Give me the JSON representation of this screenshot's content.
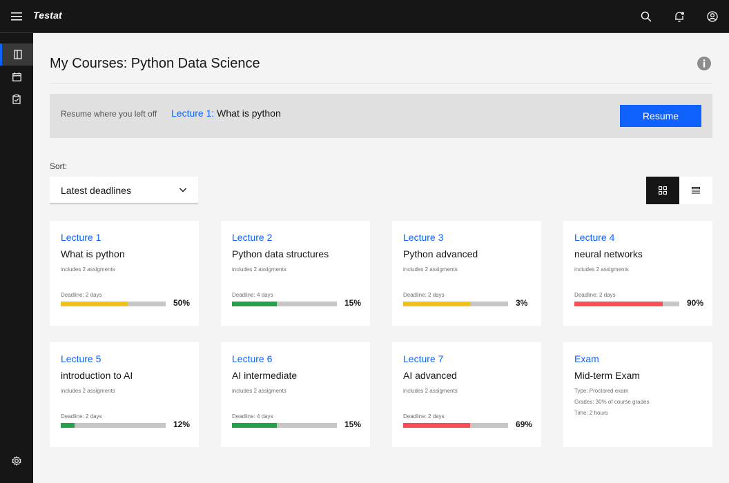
{
  "app": {
    "brand": "Testat"
  },
  "topbar": {
    "icons": [
      "menu-icon",
      "search-icon",
      "notification-icon",
      "user-icon"
    ]
  },
  "sidenav": {
    "icons": [
      "book-icon",
      "calendar-icon",
      "clipboard-icon",
      "settings-icon"
    ]
  },
  "page": {
    "title": "My Courses: Python Data Science"
  },
  "resume": {
    "label": "Resume where you left off",
    "lecture": "Lecture 1:",
    "topic": "What is python",
    "button": "Resume"
  },
  "sort": {
    "label": "Sort:",
    "value": "Latest deadlines"
  },
  "colors": {
    "accent": "#0f62fe",
    "yellow": "#f1c21b",
    "green": "#24a148",
    "red": "#fa4d56"
  },
  "cards": [
    {
      "lecture": "Lecture 1",
      "title": "What is python",
      "subtitle": "includes 2 assigments",
      "deadline": "Deadline: 2 days",
      "percent": "50%",
      "progress": 0.64,
      "color": "#f1c21b"
    },
    {
      "lecture": "Lecture 2",
      "title": "Python data structures",
      "subtitle": "includes 2 assigments",
      "deadline": "Deadline: 4 days",
      "percent": "15%",
      "progress": 0.43,
      "color": "#24a148"
    },
    {
      "lecture": "Lecture 3",
      "title": "Python advanced",
      "subtitle": "includes 2 assigments",
      "deadline": "Deadline: 2 days",
      "percent": "3%",
      "progress": 0.64,
      "color": "#f1c21b"
    },
    {
      "lecture": "Lecture 4",
      "title": "neural networks",
      "subtitle": "includes 2 assigments",
      "deadline": "Deadline: 2 days",
      "percent": "90%",
      "progress": 0.84,
      "color": "#fa4d56"
    },
    {
      "lecture": "Lecture 5",
      "title": "introduction to AI",
      "subtitle": "includes 2 assigments",
      "deadline": "Deadline: 2 days",
      "percent": "12%",
      "progress": 0.13,
      "color": "#24a148"
    },
    {
      "lecture": "Lecture 6",
      "title": "AI intermediate",
      "subtitle": "includes 2 assigments",
      "deadline": "Deadline: 4 days",
      "percent": "15%",
      "progress": 0.43,
      "color": "#24a148"
    },
    {
      "lecture": "Lecture 7",
      "title": "AI advanced",
      "subtitle": "includes 2 assigments",
      "deadline": "Deadline: 2 days",
      "percent": "69%",
      "progress": 0.64,
      "color": "#fa4d56"
    }
  ],
  "exam": {
    "label": "Exam",
    "title": "Mid-term Exam",
    "type": "Type: Proctored exam",
    "grades": "Grades: 30% of course grades",
    "time": "Time: 2 hours"
  }
}
